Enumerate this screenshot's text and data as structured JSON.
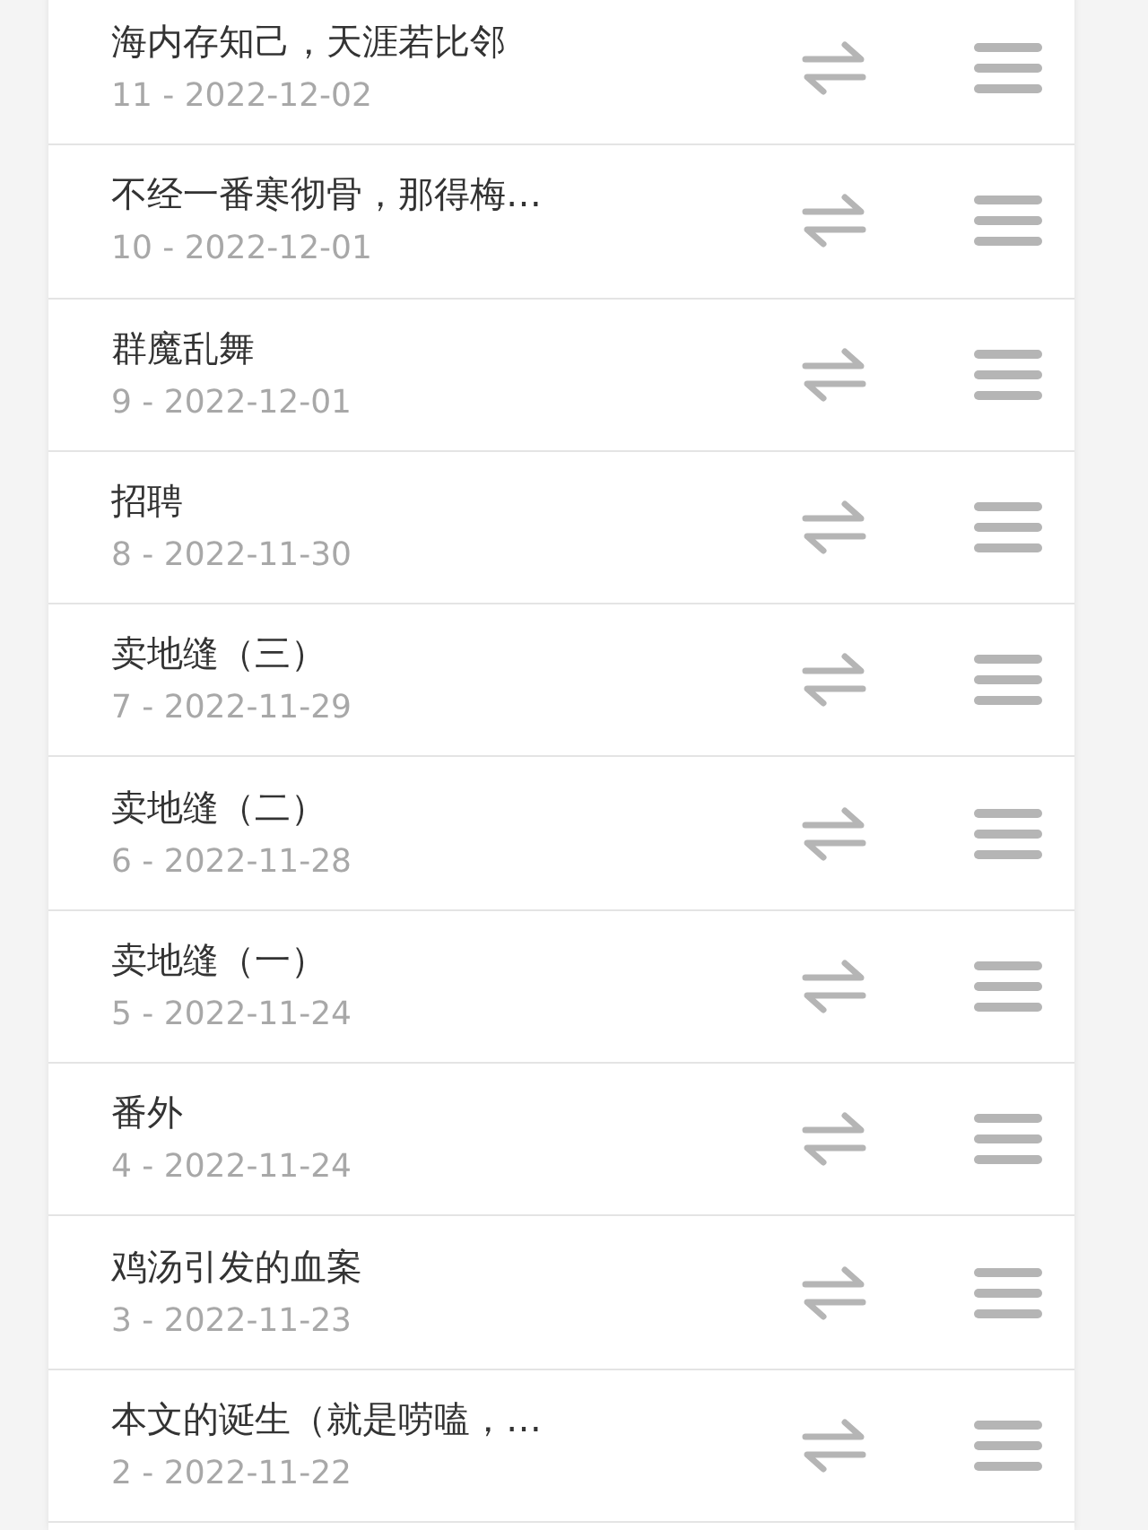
{
  "chapters": [
    {
      "title": "海内存知己，天涯若比邻",
      "date": "11 - 2022-12-02"
    },
    {
      "title": "不经一番寒彻骨，那得梅…",
      "date": "10 - 2022-12-01"
    },
    {
      "title": "群魔乱舞",
      "date": "9 - 2022-12-01"
    },
    {
      "title": "招聘",
      "date": "8 - 2022-11-30"
    },
    {
      "title": "卖地缝（三）",
      "date": "7 - 2022-11-29"
    },
    {
      "title": "卖地缝（二）",
      "date": "6 - 2022-11-28"
    },
    {
      "title": "卖地缝（一）",
      "date": "5 - 2022-11-24"
    },
    {
      "title": "番外",
      "date": "4 - 2022-11-24"
    },
    {
      "title": "鸡汤引发的血案",
      "date": "3 - 2022-11-23"
    },
    {
      "title": "本文的诞生（就是唠嗑，…",
      "date": "2 - 2022-11-22"
    }
  ]
}
